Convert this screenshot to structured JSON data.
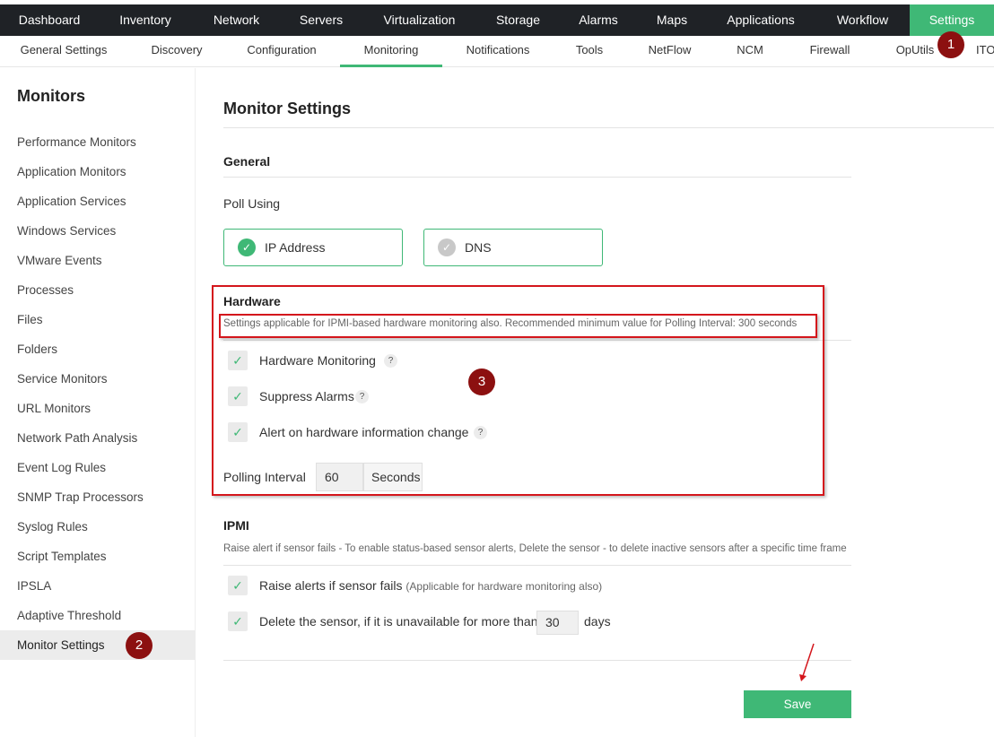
{
  "top_nav": [
    "Dashboard",
    "Inventory",
    "Network",
    "Servers",
    "Virtualization",
    "Storage",
    "Alarms",
    "Maps",
    "Applications",
    "Workflow",
    "Settings"
  ],
  "top_nav_active": "Settings",
  "sub_nav": [
    "General Settings",
    "Discovery",
    "Configuration",
    "Monitoring",
    "Notifications",
    "Tools",
    "NetFlow",
    "NCM",
    "Firewall",
    "OpUtils",
    "ITO"
  ],
  "sub_nav_active": "Monitoring",
  "sidebar": {
    "title": "Monitors",
    "items": [
      "Performance Monitors",
      "Application Monitors",
      "Application Services",
      "Windows Services",
      "VMware Events",
      "Processes",
      "Files",
      "Folders",
      "Service Monitors",
      "URL Monitors",
      "Network Path Analysis",
      "Event Log Rules",
      "SNMP Trap Processors",
      "Syslog Rules",
      "Script Templates",
      "IPSLA",
      "Adaptive Threshold",
      "Monitor Settings"
    ],
    "active": "Monitor Settings"
  },
  "badges": {
    "one": "1",
    "two": "2",
    "three": "3"
  },
  "main": {
    "title": "Monitor Settings",
    "general": {
      "title": "General",
      "poll_using_label": "Poll Using",
      "options": [
        {
          "label": "IP Address",
          "selected": true
        },
        {
          "label": "DNS",
          "selected": false
        }
      ]
    },
    "hardware": {
      "title": "Hardware",
      "note": "Settings applicable for IPMI-based hardware monitoring also. Recommended minimum value for Polling Interval: 300 seconds",
      "checks": [
        {
          "label": "Hardware Monitoring",
          "checked": true
        },
        {
          "label": "Suppress Alarms",
          "checked": true
        },
        {
          "label": "Alert on hardware information change",
          "checked": true
        }
      ],
      "polling_label": "Polling Interval",
      "polling_value": "60",
      "polling_unit": "Seconds"
    },
    "ipmi": {
      "title": "IPMI",
      "note": "Raise alert if sensor fails - To enable status-based sensor alerts, Delete the sensor - to delete inactive sensors after a specific time frame",
      "raise_label": "Raise alerts if sensor fails",
      "raise_note": "(Applicable for hardware monitoring also)",
      "delete_label": "Delete the sensor, if it is unavailable for more than",
      "delete_value": "30",
      "delete_unit": "days"
    },
    "help_glyph": "?",
    "check_glyph": "✓",
    "save_label": "Save"
  },
  "colors": {
    "accent": "#3fb876",
    "topbar": "#1f2226",
    "annotation": "#d4161c",
    "badge": "#8c1010"
  }
}
